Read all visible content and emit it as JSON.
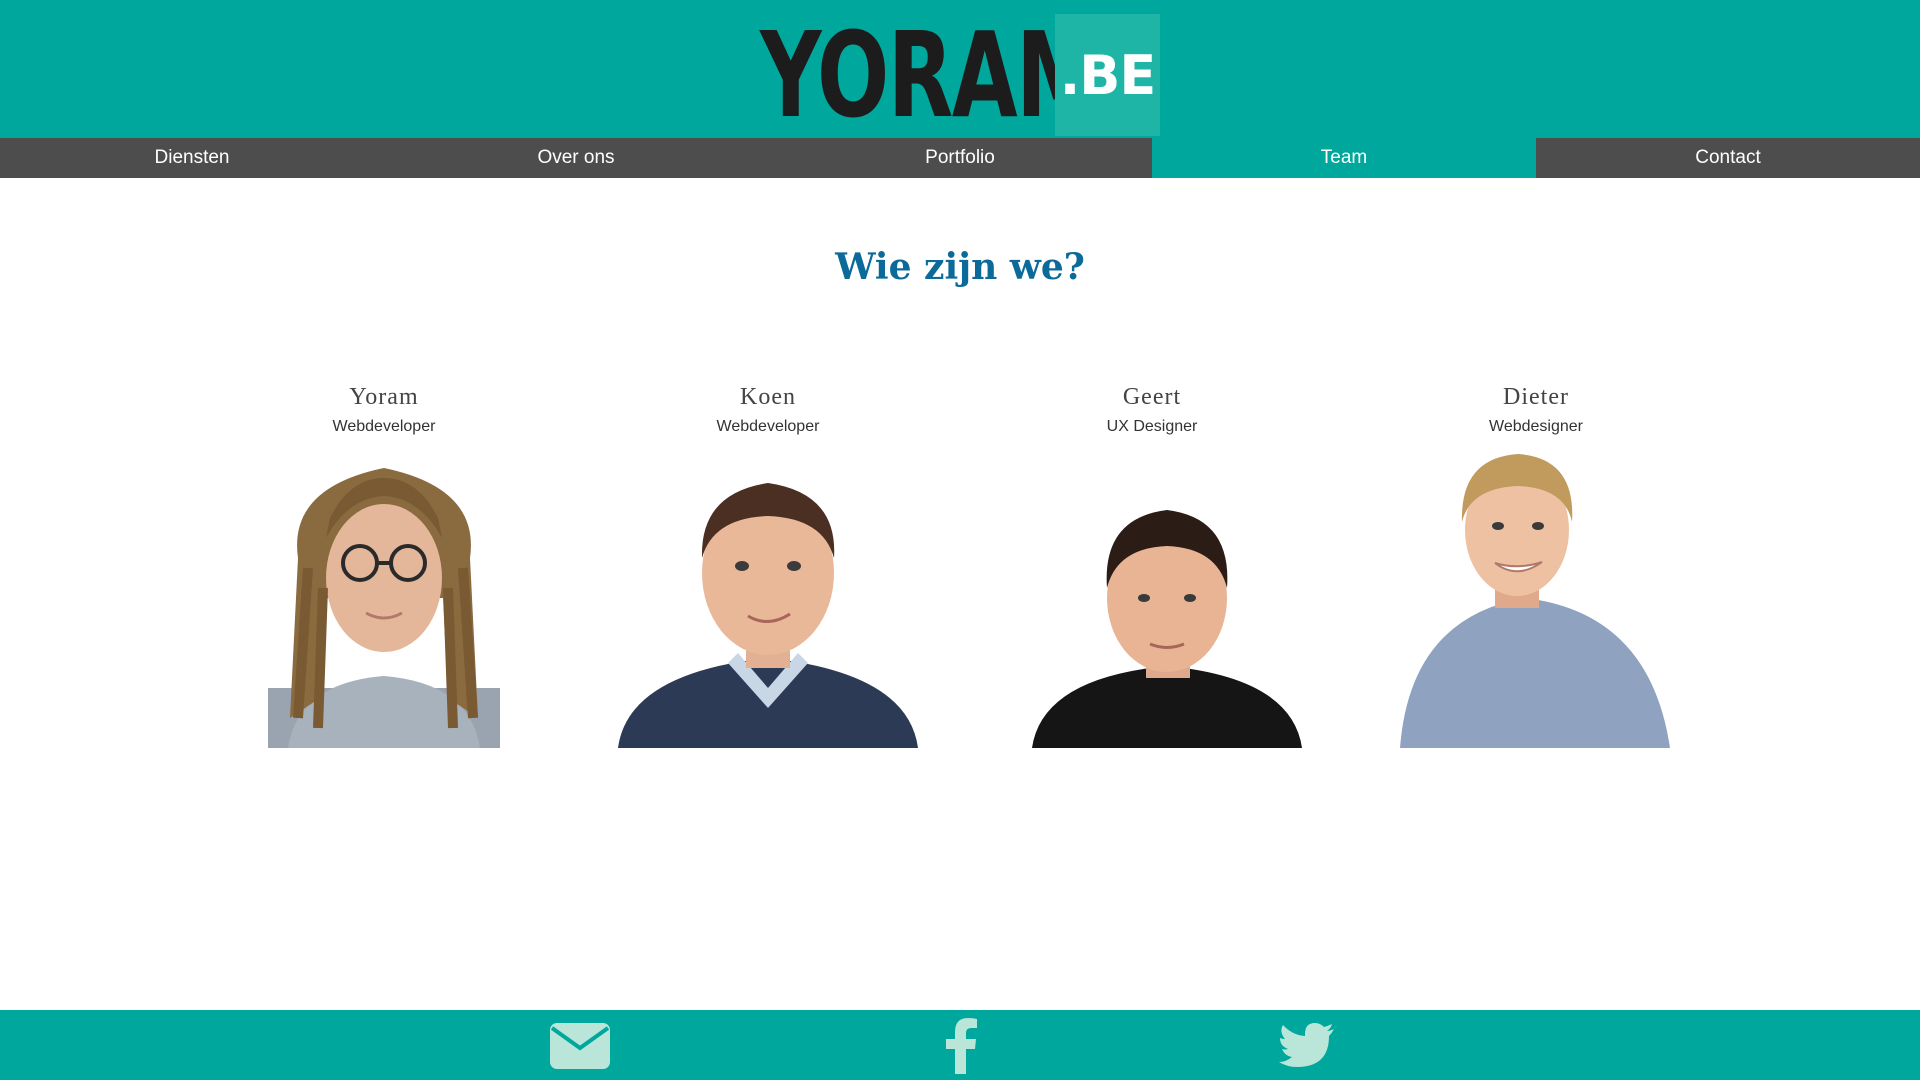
{
  "header": {
    "logo_main": "YORAM",
    "logo_tld": ".BE"
  },
  "nav": {
    "items": [
      {
        "label": "Diensten"
      },
      {
        "label": "Over ons"
      },
      {
        "label": "Portfolio"
      },
      {
        "label": "Team",
        "active": true
      },
      {
        "label": "Contact"
      }
    ]
  },
  "team": {
    "title": "Wie zijn we?",
    "members": [
      {
        "name": "Yoram",
        "role": "Webdeveloper"
      },
      {
        "name": "Koen",
        "role": "Webdeveloper"
      },
      {
        "name": "Geert",
        "role": "UX Designer"
      },
      {
        "name": "Dieter",
        "role": "Webdesigner"
      }
    ]
  },
  "footer": {
    "icons": [
      "envelope-icon",
      "facebook-icon",
      "twitter-icon"
    ]
  },
  "colors": {
    "brand": "#00a79d",
    "nav": "#4d4d4d",
    "title": "#0b6a99",
    "footer_icon": "#b9e6d9"
  }
}
